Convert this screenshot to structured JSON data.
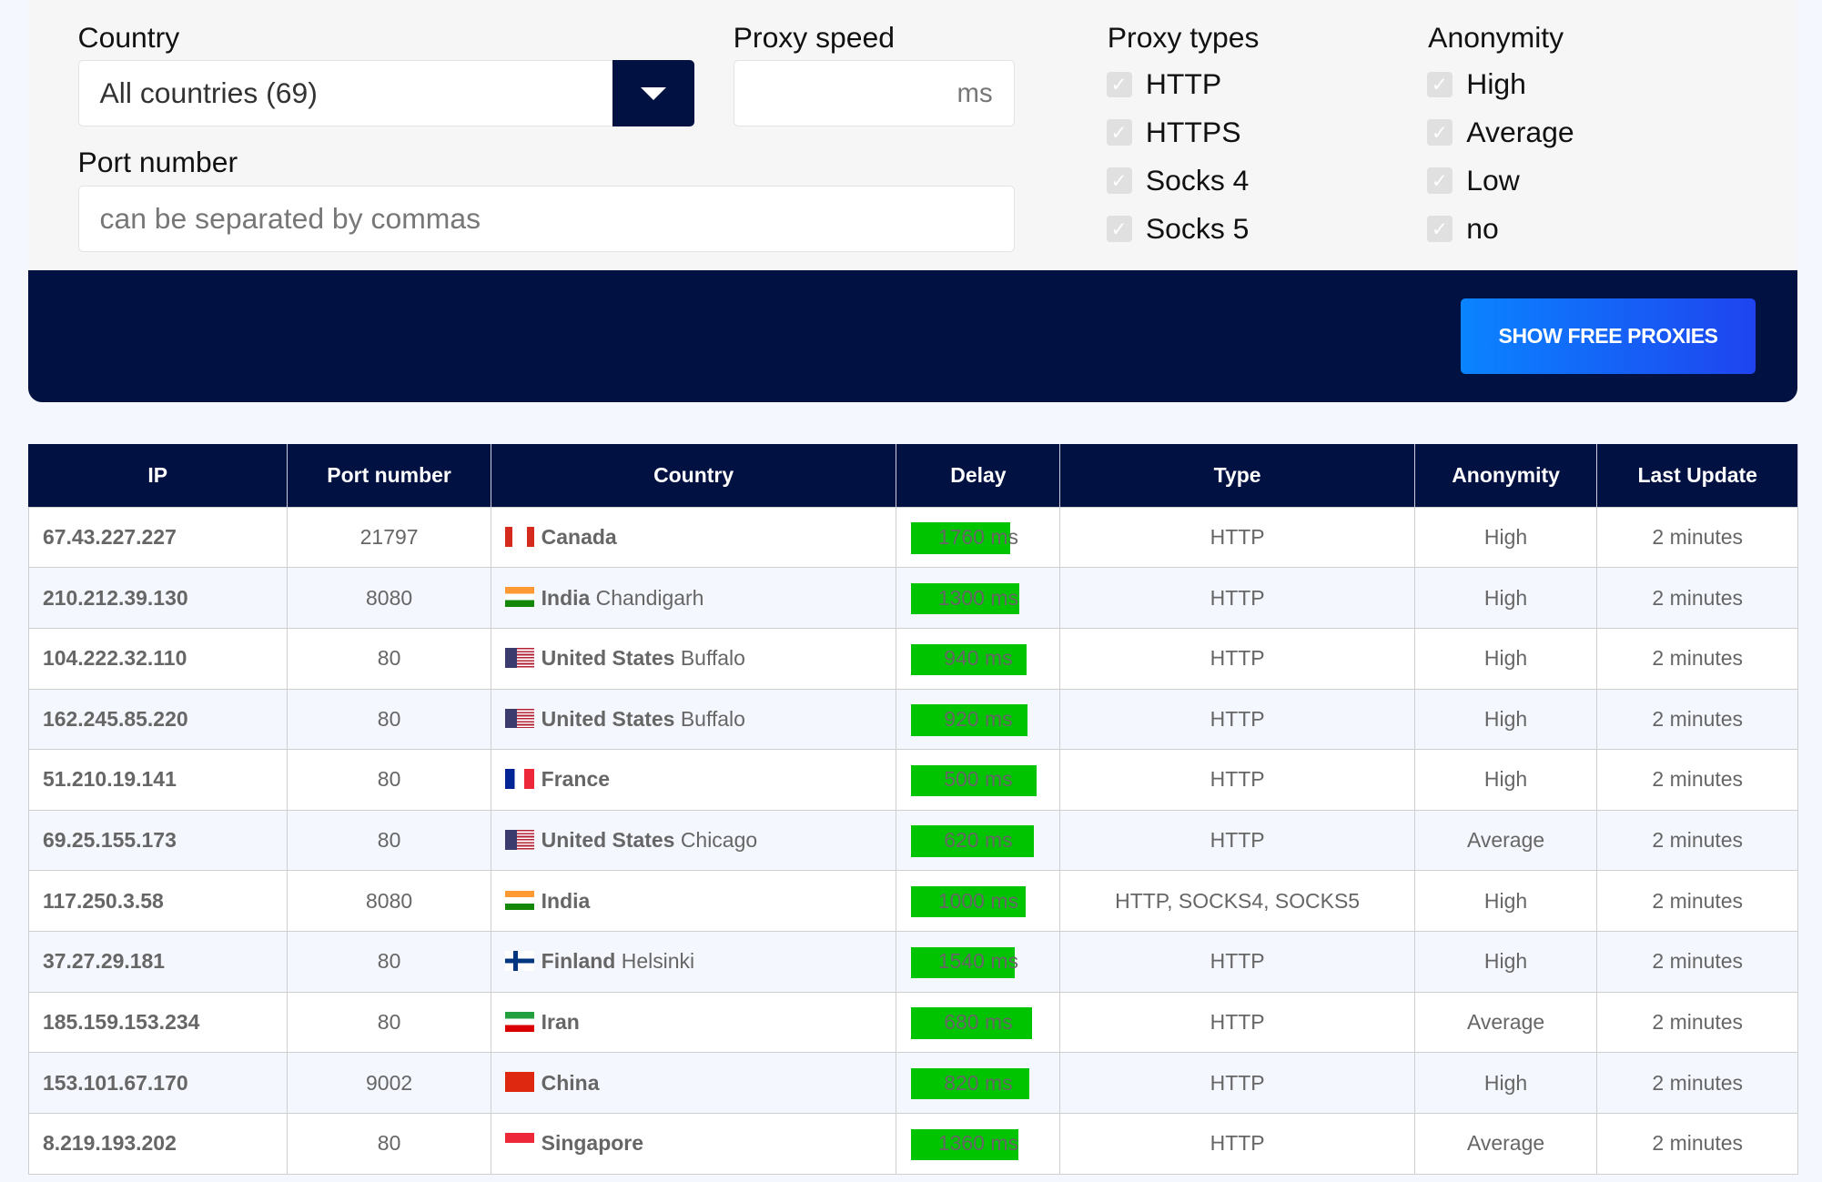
{
  "filters": {
    "country_label": "Country",
    "country_value": "All countries (69)",
    "speed_label": "Proxy speed",
    "speed_unit": "ms",
    "port_label": "Port number",
    "port_placeholder": "can be separated by commas",
    "types_label": "Proxy types",
    "types": [
      {
        "label": "HTTP",
        "checked": true
      },
      {
        "label": "HTTPS",
        "checked": true
      },
      {
        "label": "Socks 4",
        "checked": true
      },
      {
        "label": "Socks 5",
        "checked": true
      }
    ],
    "anon_label": "Anonymity",
    "anon": [
      {
        "label": "High",
        "checked": true
      },
      {
        "label": "Average",
        "checked": true
      },
      {
        "label": "Low",
        "checked": true
      },
      {
        "label": "no",
        "checked": true
      }
    ],
    "show_button": "SHOW FREE PROXIES"
  },
  "colors": {
    "navy": "#001142",
    "delay_bar": "#00c400",
    "button_start": "#0a84ff",
    "button_end": "#1f44ef"
  },
  "table": {
    "headers": [
      "IP",
      "Port number",
      "Country",
      "Delay",
      "Type",
      "Anonymity",
      "Last Update"
    ],
    "rows": [
      {
        "ip": "67.43.227.227",
        "port": "21797",
        "flag": "ca",
        "country": "Canada",
        "city": "",
        "delay": 1760,
        "delay_text": "1760 ms",
        "type": "HTTP",
        "anon": "High",
        "updated": "2 minutes"
      },
      {
        "ip": "210.212.39.130",
        "port": "8080",
        "flag": "in",
        "country": "India",
        "city": "Chandigarh",
        "delay": 1300,
        "delay_text": "1300 ms",
        "type": "HTTP",
        "anon": "High",
        "updated": "2 minutes"
      },
      {
        "ip": "104.222.32.110",
        "port": "80",
        "flag": "us",
        "country": "United States",
        "city": "Buffalo",
        "delay": 940,
        "delay_text": "940 ms",
        "type": "HTTP",
        "anon": "High",
        "updated": "2 minutes"
      },
      {
        "ip": "162.245.85.220",
        "port": "80",
        "flag": "us",
        "country": "United States",
        "city": "Buffalo",
        "delay": 920,
        "delay_text": "920 ms",
        "type": "HTTP",
        "anon": "High",
        "updated": "2 minutes"
      },
      {
        "ip": "51.210.19.141",
        "port": "80",
        "flag": "fr",
        "country": "France",
        "city": "",
        "delay": 500,
        "delay_text": "500 ms",
        "type": "HTTP",
        "anon": "High",
        "updated": "2 minutes"
      },
      {
        "ip": "69.25.155.173",
        "port": "80",
        "flag": "us",
        "country": "United States",
        "city": "Chicago",
        "delay": 620,
        "delay_text": "620 ms",
        "type": "HTTP",
        "anon": "Average",
        "updated": "2 minutes"
      },
      {
        "ip": "117.250.3.58",
        "port": "8080",
        "flag": "in",
        "country": "India",
        "city": "",
        "delay": 1000,
        "delay_text": "1000 ms",
        "type": "HTTP, SOCKS4, SOCKS5",
        "anon": "High",
        "updated": "2 minutes"
      },
      {
        "ip": "37.27.29.181",
        "port": "80",
        "flag": "fi",
        "country": "Finland",
        "city": "Helsinki",
        "delay": 1540,
        "delay_text": "1540 ms",
        "type": "HTTP",
        "anon": "High",
        "updated": "2 minutes"
      },
      {
        "ip": "185.159.153.234",
        "port": "80",
        "flag": "ir",
        "country": "Iran",
        "city": "",
        "delay": 680,
        "delay_text": "680 ms",
        "type": "HTTP",
        "anon": "Average",
        "updated": "2 minutes"
      },
      {
        "ip": "153.101.67.170",
        "port": "9002",
        "flag": "cn",
        "country": "China",
        "city": "",
        "delay": 820,
        "delay_text": "820 ms",
        "type": "HTTP",
        "anon": "High",
        "updated": "2 minutes"
      },
      {
        "ip": "8.219.193.202",
        "port": "80",
        "flag": "sg",
        "country": "Singapore",
        "city": "",
        "delay": 1360,
        "delay_text": "1360 ms",
        "type": "HTTP",
        "anon": "Average",
        "updated": "2 minutes"
      }
    ]
  }
}
